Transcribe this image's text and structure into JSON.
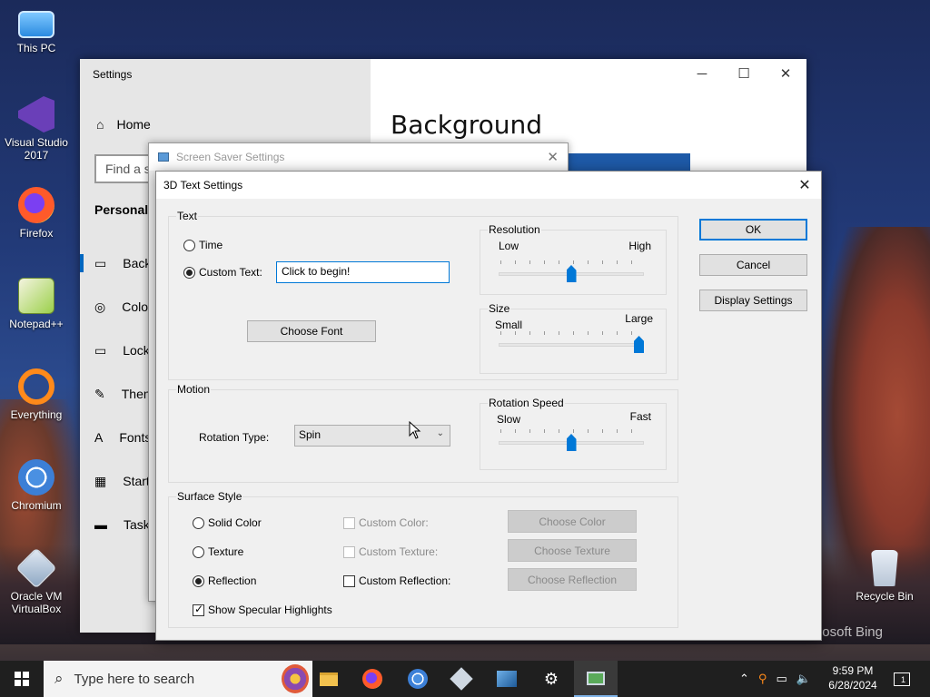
{
  "desktop": {
    "icons": [
      {
        "label": "This PC",
        "icon": "monitor-icon"
      },
      {
        "label": "Visual Studio 2017",
        "icon": "visual-studio-icon"
      },
      {
        "label": "Firefox",
        "icon": "firefox-icon"
      },
      {
        "label": "Notepad++",
        "icon": "notepad-plus-plus-icon"
      },
      {
        "label": "Everything",
        "icon": "everything-search-icon"
      },
      {
        "label": "Chromium",
        "icon": "chromium-icon"
      },
      {
        "label": "Oracle VM VirtualBox",
        "icon": "virtualbox-icon"
      },
      {
        "label": "Recycle Bin",
        "icon": "recycle-bin-icon"
      }
    ],
    "wallpaper_caption": "rosoft Bing"
  },
  "settings_window": {
    "title": "Settings",
    "home": "Home",
    "search_placeholder": "Find a s",
    "section": "Personaliz",
    "nav": [
      "Back",
      "Colo",
      "Lock",
      "Then",
      "Fonts",
      "Start",
      "Taskb"
    ],
    "page_title": "Background"
  },
  "screen_saver_window": {
    "title": "Screen Saver Settings"
  },
  "dialog": {
    "title": "3D Text Settings",
    "text_group": {
      "label": "Text",
      "time_label": "Time",
      "custom_text_label": "Custom Text:",
      "custom_text_value": "Click to begin!",
      "selected": "custom_text",
      "choose_font": "Choose Font"
    },
    "resolution": {
      "label": "Resolution",
      "low": "Low",
      "high": "High",
      "value_fraction": 0.5
    },
    "size": {
      "label": "Size",
      "small": "Small",
      "large": "Large",
      "value_fraction": 1.0
    },
    "motion_group": {
      "label": "Motion",
      "rotation_type_label": "Rotation Type:",
      "rotation_type_value": "Spin"
    },
    "rotation_speed": {
      "label": "Rotation Speed",
      "slow": "Slow",
      "fast": "Fast",
      "value_fraction": 0.5
    },
    "surface_group": {
      "label": "Surface Style",
      "solid_color": "Solid Color",
      "texture": "Texture",
      "reflection": "Reflection",
      "selected": "reflection",
      "custom_color": "Custom Color:",
      "custom_texture": "Custom Texture:",
      "custom_reflection": "Custom Reflection:",
      "choose_color": "Choose Color",
      "choose_texture": "Choose Texture",
      "choose_reflection": "Choose Reflection",
      "show_specular": "Show Specular Highlights",
      "show_specular_checked": true
    },
    "buttons": {
      "ok": "OK",
      "cancel": "Cancel",
      "display_settings": "Display Settings"
    }
  },
  "taskbar": {
    "search_placeholder": "Type here to search",
    "time": "9:59 PM",
    "date": "6/28/2024",
    "notification_count": "1"
  }
}
